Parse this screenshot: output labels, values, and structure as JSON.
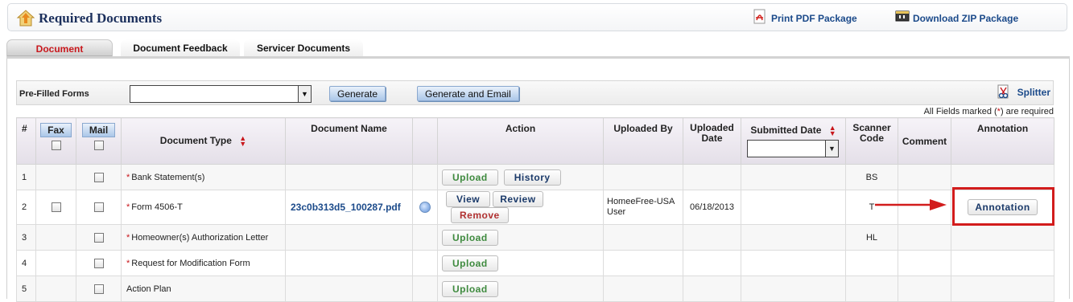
{
  "header": {
    "title": "Required Documents",
    "print_pdf": "Print PDF Package",
    "download_zip": "Download ZIP Package"
  },
  "tabs": [
    {
      "label": "Document",
      "active": true
    },
    {
      "label": "Document Feedback",
      "active": false
    },
    {
      "label": "Servicer Documents",
      "active": false
    }
  ],
  "prefilled": {
    "label": "Pre-Filled Forms",
    "selected": "",
    "generate": "Generate",
    "generate_email": "Generate and Email",
    "splitter": "Splitter"
  },
  "required_note": {
    "prefix": "All Fields marked (",
    "star": "*",
    "suffix": ") are required"
  },
  "table": {
    "headers": {
      "num": "#",
      "fax": "Fax",
      "mail": "Mail",
      "document_type": "Document Type",
      "document_name": "Document Name",
      "action": "Action",
      "uploaded_by": "Uploaded By",
      "uploaded_date_1": "Uploaded",
      "uploaded_date_2": "Date",
      "submitted_date": "Submitted Date",
      "scanner_code_1": "Scanner",
      "scanner_code_2": "Code",
      "comment": "Comment",
      "annotation": "Annotation"
    },
    "rows": [
      {
        "num": "1",
        "required": true,
        "type": "Bank Statement(s)",
        "name": "",
        "uploaded_by_1": "",
        "uploaded_by_2": "",
        "uploaded_date": "",
        "scanner": "BS"
      },
      {
        "num": "2",
        "required": true,
        "type": "Form 4506-T",
        "name": "23c0b313d5_100287.pdf",
        "uploaded_by_1": "HomeeFree-USA",
        "uploaded_by_2": "User",
        "uploaded_date": "06/18/2013",
        "scanner": "T"
      },
      {
        "num": "3",
        "required": true,
        "type": "Homeowner(s) Authorization Letter",
        "name": "",
        "uploaded_by_1": "",
        "uploaded_by_2": "",
        "uploaded_date": "",
        "scanner": "HL"
      },
      {
        "num": "4",
        "required": true,
        "type": "Request for Modification Form",
        "name": "",
        "uploaded_by_1": "",
        "uploaded_by_2": "",
        "uploaded_date": "",
        "scanner": ""
      },
      {
        "num": "5",
        "required": false,
        "type": "Action Plan",
        "name": "",
        "uploaded_by_1": "",
        "uploaded_by_2": "",
        "uploaded_date": "",
        "scanner": ""
      }
    ],
    "buttons": {
      "upload": "Upload",
      "history": "History",
      "view": "View",
      "review": "Review",
      "remove": "Remove",
      "annotation": "Annotation"
    }
  },
  "colors": {
    "accent_red": "#c8171c",
    "link_blue": "#1b4a8a",
    "upload_green": "#3e8a3e",
    "highlight_red": "#d21c1c"
  }
}
